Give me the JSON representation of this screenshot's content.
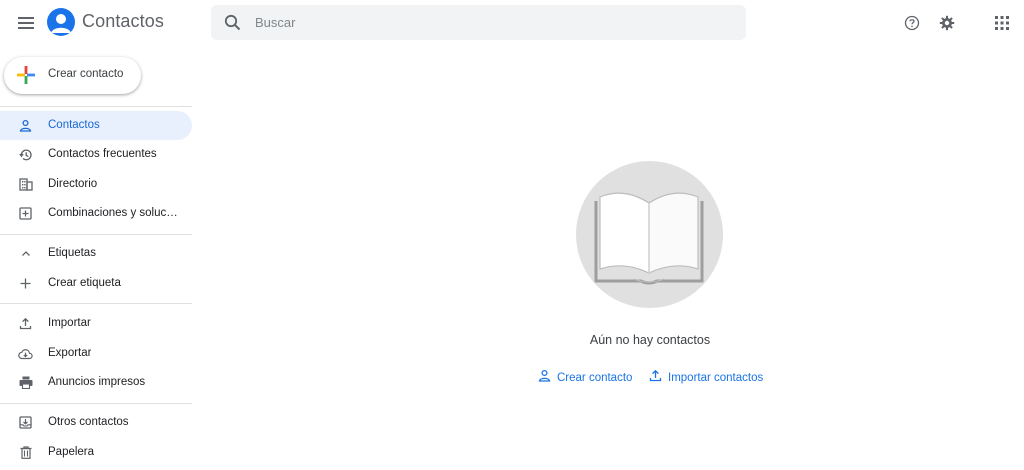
{
  "header": {
    "app_title": "Contactos",
    "search_placeholder": "Buscar",
    "menu_icon": "menu-icon",
    "help_icon": "help-icon",
    "settings_icon": "settings-icon",
    "apps_icon": "apps-grid-icon"
  },
  "create_button": {
    "label": "Crear contacto"
  },
  "sidebar": {
    "items": [
      {
        "label": "Contactos",
        "icon": "person-icon",
        "active": true
      },
      {
        "label": "Contactos frecuentes",
        "icon": "history-icon"
      },
      {
        "label": "Directorio",
        "icon": "building-icon"
      },
      {
        "label": "Combinaciones y solucionar problemas",
        "icon": "add-box-icon"
      }
    ],
    "labels_section": {
      "title": "Etiquetas",
      "create_label": "Crear etiqueta"
    },
    "tools": [
      {
        "label": "Importar",
        "icon": "upload-icon"
      },
      {
        "label": "Exportar",
        "icon": "cloud-download-icon"
      },
      {
        "label": "Anuncios impresos",
        "icon": "print-icon"
      }
    ],
    "other": [
      {
        "label": "Otros contactos",
        "icon": "inbox-icon"
      },
      {
        "label": "Papelera",
        "icon": "trash-icon"
      }
    ]
  },
  "main": {
    "empty_message": "Aún no hay contactos",
    "create_action": "Crear contacto",
    "import_action": "Importar contactos"
  },
  "colors": {
    "accent": "#1a73e8",
    "active_bg": "#e8f0fe",
    "search_bg": "#f1f3f4"
  }
}
